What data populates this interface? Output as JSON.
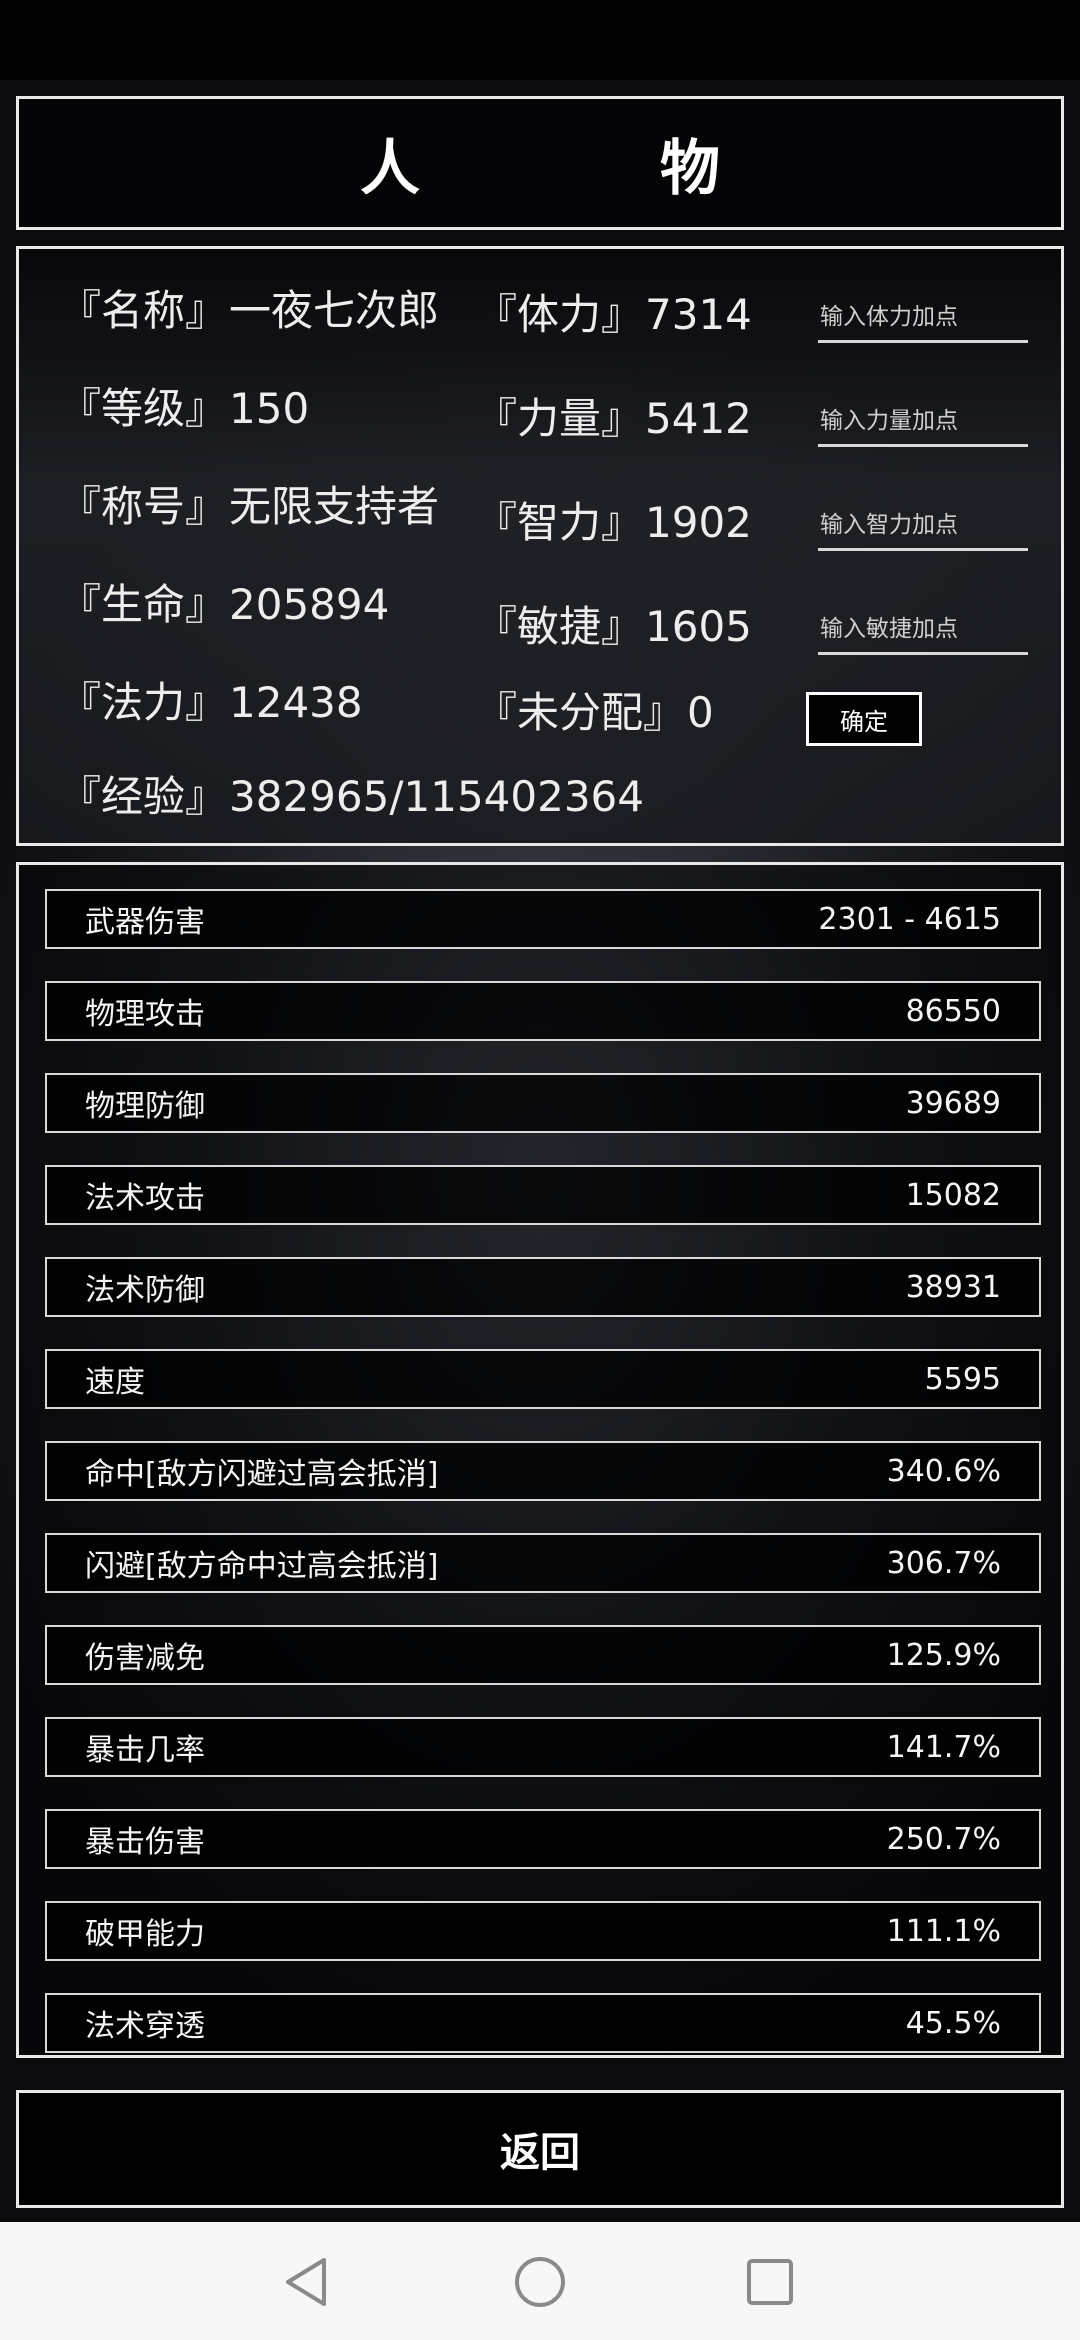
{
  "title": "人　物",
  "info": {
    "name_label": "『名称』",
    "name": "一夜七次郎",
    "level_label": "『等级』",
    "level": "150",
    "honor_label": "『称号』",
    "honor": "无限支持者",
    "hp_label": "『生命』",
    "hp": "205894",
    "mp_label": "『法力』",
    "mp": "12438",
    "exp_label": "『经验』",
    "exp": "382965/115402364"
  },
  "attributes": {
    "stamina_label": "『体力』",
    "stamina": "7314",
    "stamina_placeholder": "输入体力加点",
    "strength_label": "『力量』",
    "strength": "5412",
    "strength_placeholder": "输入力量加点",
    "intellect_label": "『智力』",
    "intellect": "1902",
    "intellect_placeholder": "输入智力加点",
    "agility_label": "『敏捷』",
    "agility": "1605",
    "agility_placeholder": "输入敏捷加点",
    "unassigned_label": "『未分配』",
    "unassigned": "0",
    "confirm_label": "确定"
  },
  "stats": [
    {
      "label": "武器伤害",
      "value": "2301 - 4615"
    },
    {
      "label": "物理攻击",
      "value": "86550"
    },
    {
      "label": "物理防御",
      "value": "39689"
    },
    {
      "label": "法术攻击",
      "value": "15082"
    },
    {
      "label": "法术防御",
      "value": "38931"
    },
    {
      "label": "速度",
      "value": "5595"
    },
    {
      "label": "命中[敌方闪避过高会抵消]",
      "value": "340.6%"
    },
    {
      "label": "闪避[敌方命中过高会抵消]",
      "value": "306.7%"
    },
    {
      "label": "伤害减免",
      "value": "125.9%"
    },
    {
      "label": "暴击几率",
      "value": "141.7%"
    },
    {
      "label": "暴击伤害",
      "value": "250.7%"
    },
    {
      "label": "破甲能力",
      "value": "111.1%"
    },
    {
      "label": "法术穿透",
      "value": "45.5%"
    }
  ],
  "back_label": "返回",
  "icons": {
    "nav_back": "triangle-back-icon",
    "nav_home": "circle-home-icon",
    "nav_recent": "square-recent-icon"
  },
  "colors": {
    "border": "#e8e8e8",
    "text": "#f2f2f2",
    "nav_bg": "#f7f7f7"
  }
}
